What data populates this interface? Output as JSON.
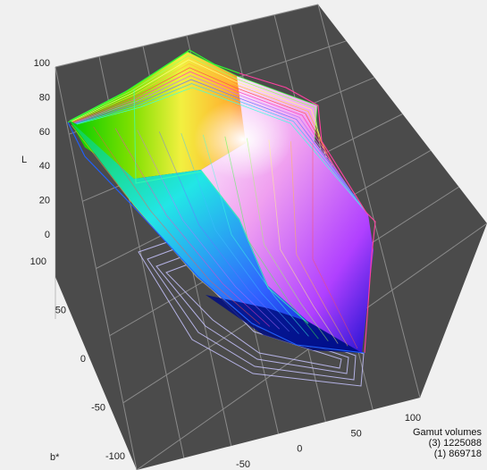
{
  "chart_data": {
    "type": "3d-wireframe-gamut",
    "axis_labels": {
      "L": "L",
      "b": "b*"
    },
    "L_ticks": [
      0,
      20,
      40,
      60,
      80,
      100
    ],
    "b_ticks": [
      100,
      50,
      0,
      -50,
      -100
    ],
    "a_ticks": [
      -50,
      0,
      50,
      100
    ],
    "legend": {
      "title": "Gamut volumes",
      "entries": [
        {
          "label": "(3)",
          "value": "1225088"
        },
        {
          "label": "(1)",
          "value": "869718"
        }
      ]
    },
    "colors": {
      "background": "#f0f0f0",
      "floor": "#4b4b4b",
      "grid": "#8c8c8c",
      "outer_gamut_wire": "#b9b6ff"
    }
  }
}
